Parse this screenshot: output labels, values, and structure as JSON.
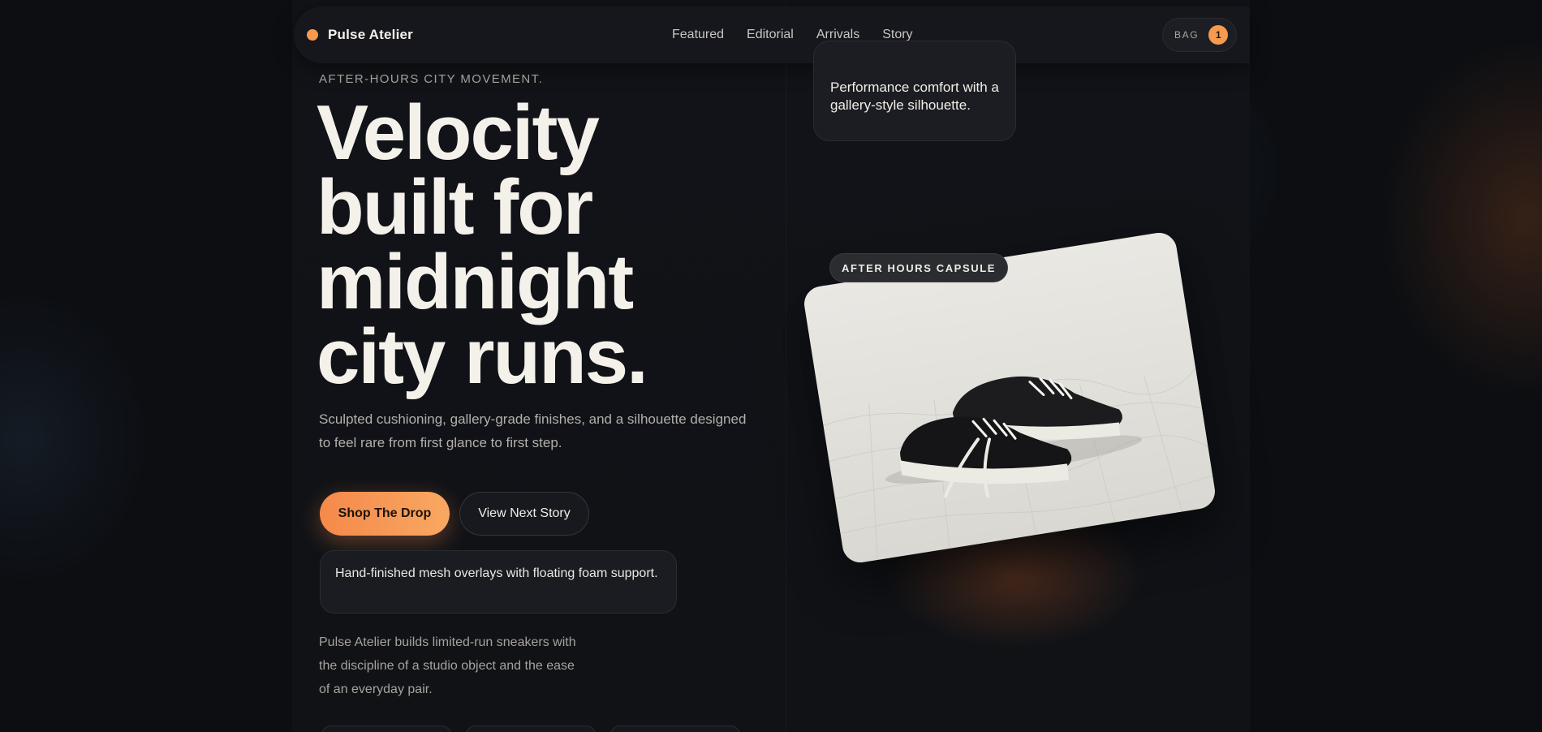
{
  "nav": {
    "brand": "Pulse Atelier",
    "links": [
      "Featured",
      "Editorial",
      "Arrivals",
      "Story"
    ],
    "bag_label": "BAG",
    "bag_count": "1"
  },
  "hero": {
    "eyebrow": "AFTER-HOURS CITY MOVEMENT.",
    "headline_lines": [
      "Velocity",
      "built for",
      "midnight",
      "city runs."
    ],
    "subtitle": "Sculpted cushioning, gallery-grade finishes, and a silhouette designed to feel rare from first glance to first step.",
    "primary_cta": "Shop The Drop",
    "secondary_cta": "View Next Story",
    "note": "Hand-finished mesh overlays with floating foam support.",
    "about": "Pulse Atelier builds limited-run sneakers with the discipline of a studio object and the ease of an everyday pair."
  },
  "feature": {
    "card_text": "Performance comfort with a gallery-style silhouette.",
    "badge": "AFTER HOURS CAPSULE"
  },
  "colors": {
    "accent": "#f59a4e",
    "background": "#0c0e12"
  }
}
